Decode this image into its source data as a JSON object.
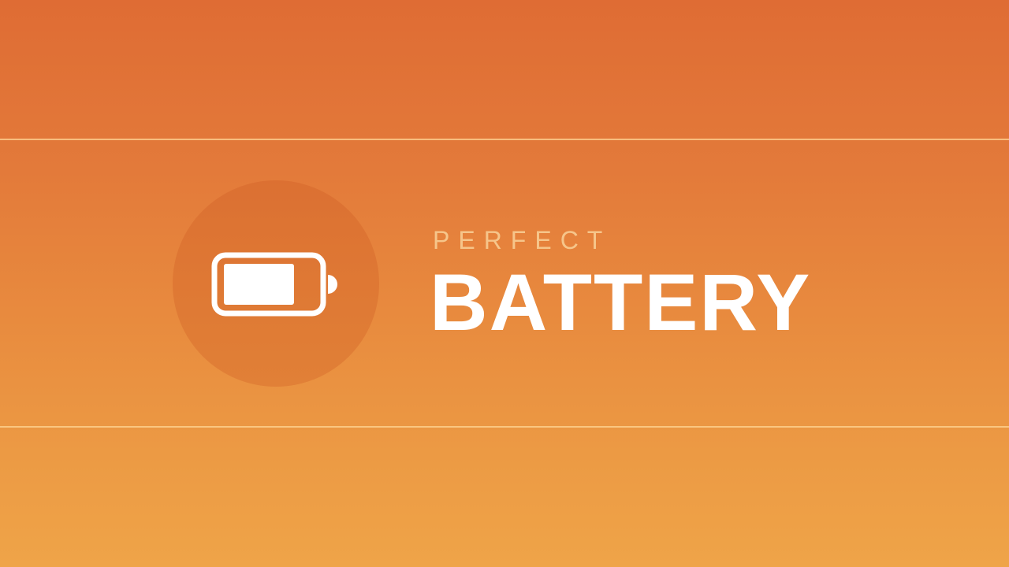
{
  "banner": {
    "subtitle": "PERFECT",
    "title": "BATTERY",
    "icon": "battery-icon",
    "battery_level": 0.75
  },
  "colors": {
    "background_top": "#df6c34",
    "background_bottom": "#efa448",
    "subtitle": "#f6c58a",
    "title": "#ffffff",
    "icon": "#ffffff",
    "circle": "#d9692f",
    "band_line": "#ffd696"
  }
}
